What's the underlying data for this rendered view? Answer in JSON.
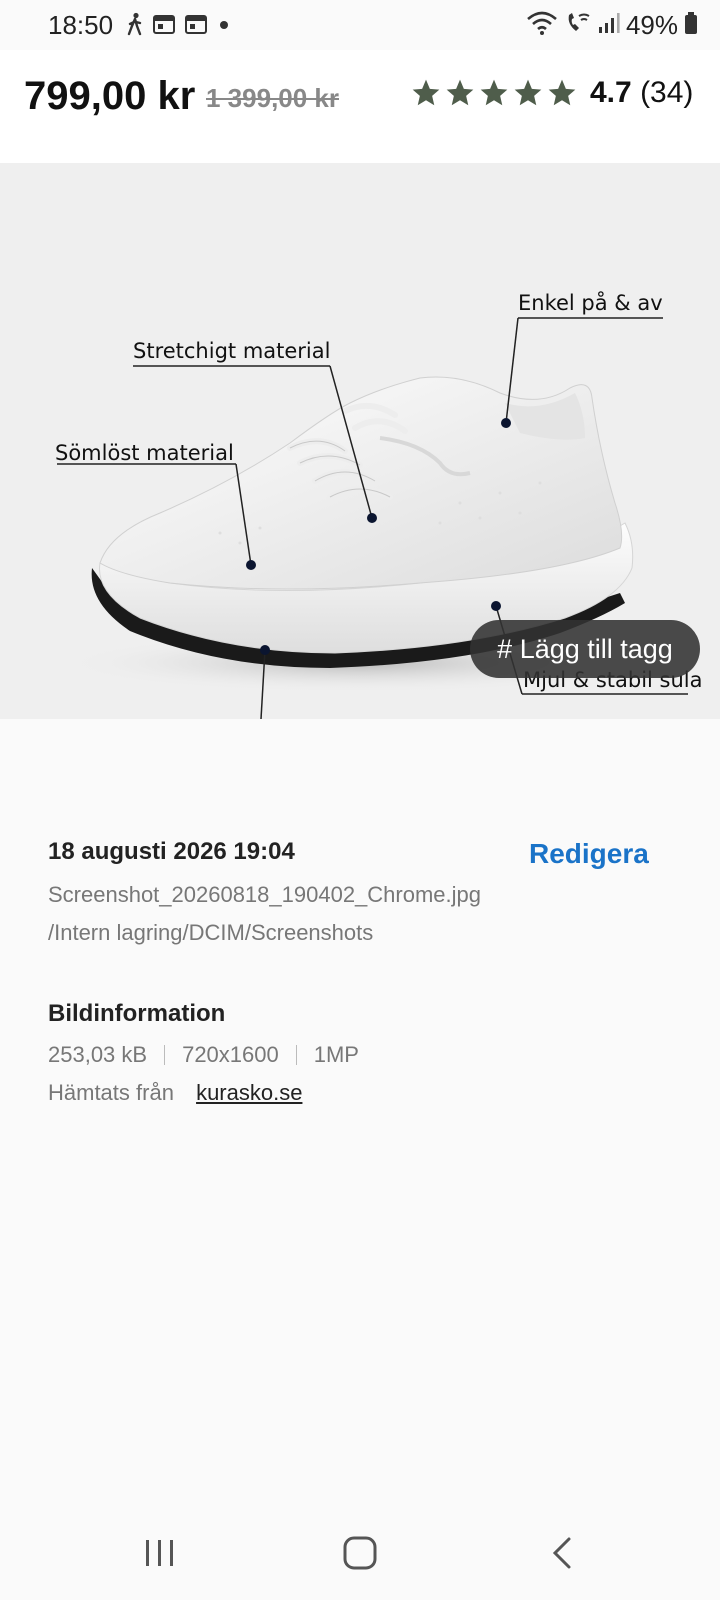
{
  "status_bar": {
    "time": "18:50",
    "battery": "49%",
    "icons": [
      "walking-icon",
      "calendar-icon",
      "calendar-icon",
      "dot-icon",
      "wifi-icon",
      "wifi-call-icon",
      "signal-icon",
      "battery-icon"
    ]
  },
  "product": {
    "price": "799,00 kr",
    "old_price": "1 399,00 kr",
    "rating_value": "4.7",
    "rating_count": "(34)",
    "stars": 5,
    "star_color": "#4f5d4b"
  },
  "photo": {
    "callouts": {
      "easy_on_off": "Enkel på & av",
      "stretch": "Stretchigt material",
      "seamless": "Sömlöst material",
      "sole": "Mjul & stabil sula"
    },
    "add_tag_label": "# Lägg till tagg"
  },
  "details": {
    "date": "18 augusti 2026 19:04",
    "edit_label": "Redigera",
    "filename": "Screenshot_20260818_190402_Chrome.jpg",
    "path": "/Intern lagring/DCIM/Screenshots",
    "info_title": "Bildinformation",
    "size": "253,03 kB",
    "resolution": "720x1600",
    "megapixels": "1MP",
    "source_label": "Hämtats från",
    "source_link": "kurasko.se"
  },
  "colors": {
    "accent": "#1a73c8",
    "background": "#fafafa"
  }
}
